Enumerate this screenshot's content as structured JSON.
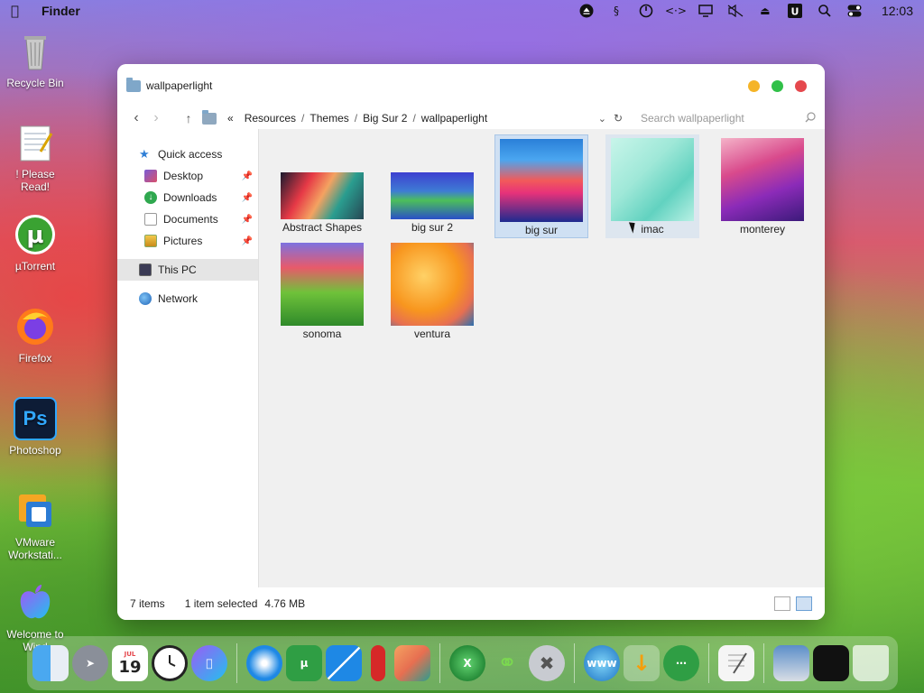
{
  "menubar": {
    "app_name": "Finder",
    "clock": "12:03",
    "status_icons": [
      "eject-icon",
      "script-icon",
      "power-icon",
      "network-code-icon",
      "display-icon",
      "mute-icon",
      "eject-icon",
      "u-icon",
      "search-icon",
      "toggle-icon"
    ]
  },
  "desktop": {
    "icons": [
      {
        "label": "Recycle Bin",
        "icon": "trash-icon"
      },
      {
        "label": "! Please Read!",
        "icon": "notepad-icon"
      },
      {
        "label": "µTorrent",
        "icon": "utorrent-icon"
      },
      {
        "label": "Firefox",
        "icon": "firefox-icon"
      },
      {
        "label": "Photoshop",
        "icon": "photoshop-icon"
      },
      {
        "label": "VMware Workstati...",
        "icon": "vmware-icon"
      },
      {
        "label": "Welcome to Wind",
        "icon": "apple-icon"
      }
    ],
    "photoshop_text": "Ps"
  },
  "window": {
    "title": "wallpaperlight",
    "path_prefix": "«",
    "breadcrumbs": [
      "Resources",
      "Themes",
      "Big Sur 2",
      "wallpaperlight"
    ],
    "search_placeholder": "Search wallpaperlight",
    "colors": {
      "close": "#e5484d",
      "minimize": "#f5b427",
      "maximize": "#30c048"
    },
    "sidebar": {
      "quick_access": "Quick access",
      "items": [
        {
          "label": "Desktop",
          "pinned": true
        },
        {
          "label": "Downloads",
          "pinned": true
        },
        {
          "label": "Documents",
          "pinned": true
        },
        {
          "label": "Pictures",
          "pinned": true
        }
      ],
      "this_pc": "This PC",
      "network": "Network"
    },
    "files": [
      {
        "name": "Abstract Shapes",
        "selected": false
      },
      {
        "name": "big sur 2",
        "selected": false
      },
      {
        "name": "big sur",
        "selected": true
      },
      {
        "name": "imac",
        "selected": false
      },
      {
        "name": "monterey",
        "selected": false
      },
      {
        "name": "sonoma",
        "selected": false
      },
      {
        "name": "ventura",
        "selected": false
      }
    ],
    "status": {
      "item_count": "7 items",
      "selection": "1 item selected",
      "size": "4.76 MB"
    }
  },
  "dock": {
    "calendar_month": "JUL",
    "calendar_day": "19",
    "items": [
      "finder-icon",
      "launchpad-icon",
      "calendar-icon",
      "clock-icon",
      "apple-icon",
      "safari-icon",
      "utorrent-icon",
      "windows-icon",
      "books-icon",
      "photos-icon",
      "xbox-icon",
      "link-icon",
      "tools-icon",
      "globe-icon",
      "download-icon",
      "network-icon",
      "textedit-icon",
      "screenshot-icon",
      "terminal-icon",
      "trash-icon"
    ]
  }
}
